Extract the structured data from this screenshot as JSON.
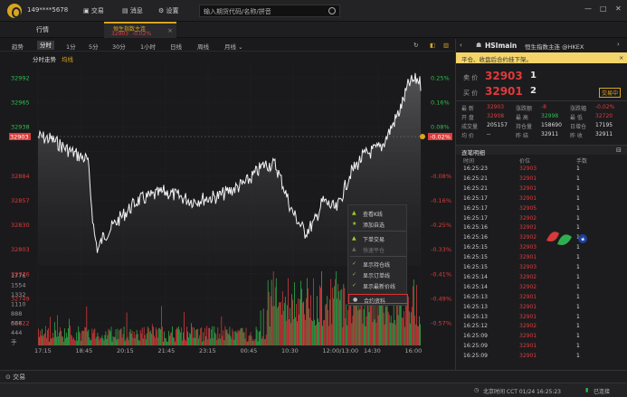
{
  "topbar": {
    "account": "149****5678",
    "menu": [
      {
        "label": "交易",
        "icon": "trade-icon"
      },
      {
        "label": "消息",
        "icon": "message-icon"
      },
      {
        "label": "设置",
        "icon": "gear-icon"
      }
    ],
    "search_placeholder": "输入期货代码/名称/拼音"
  },
  "tabs": {
    "main": "行情",
    "active_title": "恒生指数主连",
    "active_price": "32903",
    "active_change": "-0.02%"
  },
  "periods": [
    "分时",
    "1分",
    "5分",
    "30分",
    "1小时",
    "日线",
    "周线",
    "月线"
  ],
  "period_first": "趋势",
  "selected_period": "分时",
  "sub": {
    "mode": "分时走势",
    "avg": "均线"
  },
  "chart": {
    "left_ticks": [
      "32992",
      "32965",
      "32938",
      "32911",
      "32884",
      "32857",
      "32830",
      "32803",
      "32776",
      "32749",
      "32722"
    ],
    "pct_ticks": [
      "0.25%",
      "0.16%",
      "0.08%",
      "0.00%",
      "-0.08%",
      "-0.16%",
      "-0.25%",
      "-0.33%",
      "-0.41%",
      "-0.49%",
      "-0.57%"
    ],
    "current": "32903",
    "current_pct": "-0.02%",
    "vol_ticks": [
      "1776",
      "1554",
      "1332",
      "1110",
      "888",
      "666",
      "444",
      "手"
    ],
    "time_ticks": [
      "17:15",
      "18:45",
      "20:15",
      "21:45",
      "23:15",
      "00:45",
      "10:30",
      "12:00/13:00",
      "14:30",
      "16:00"
    ]
  },
  "context_menu": [
    {
      "label": "查看K线",
      "icon": "chart-icon",
      "disabled": false
    },
    {
      "label": "添加自选",
      "icon": "star-icon",
      "disabled": false
    },
    {
      "label": "下单交易",
      "icon": "order-icon",
      "disabled": false
    },
    {
      "label": "快速平仓",
      "icon": "close-pos-icon",
      "disabled": true
    },
    {
      "label": "显示持仓线",
      "icon": "check-icon",
      "disabled": false
    },
    {
      "label": "显示订单线",
      "icon": "check-icon",
      "disabled": false
    },
    {
      "label": "显示最新价线",
      "icon": "check-icon",
      "disabled": false
    },
    {
      "label": "合约资料",
      "icon": "info-icon",
      "disabled": false,
      "highlighted": true
    }
  ],
  "quote": {
    "symbol": "HSImain",
    "name": "恒生指数主连 @HKEX",
    "notice": "平仓、收盘后合约挂下架。",
    "sell_label": "卖 价",
    "sell_price": "32903",
    "sell_qty": "1",
    "buy_label": "买 价",
    "buy_price": "32901",
    "buy_qty": "2",
    "trade_btn": "交易中",
    "stats": [
      [
        "最 新",
        "32903",
        "涨跌额",
        "-8",
        "涨跌幅",
        "-0.02%"
      ],
      [
        "开 盘",
        "32908",
        "最 高",
        "32998",
        "最 低",
        "32720"
      ],
      [
        "成交量",
        "205157",
        "持仓量",
        "158690",
        "日增仓",
        "17195"
      ],
      [
        "均 价",
        "--",
        "昨 结",
        "32911",
        "昨 收",
        "32911"
      ]
    ],
    "ticks_title": "逐笔明细",
    "ticks_headers": [
      "时间",
      "价位",
      "手数"
    ],
    "ticks": [
      [
        "16:25:23",
        "32903",
        "1"
      ],
      [
        "16:25:21",
        "32901",
        "1"
      ],
      [
        "16:25:21",
        "32901",
        "1"
      ],
      [
        "16:25:17",
        "32901",
        "1"
      ],
      [
        "16:25:17",
        "32905",
        "1"
      ],
      [
        "16:25:17",
        "32902",
        "1"
      ],
      [
        "16:25:16",
        "32901",
        "1"
      ],
      [
        "16:25:16",
        "32902",
        "1"
      ],
      [
        "16:25:15",
        "32903",
        "1"
      ],
      [
        "16:25:15",
        "32901",
        "1"
      ],
      [
        "16:25:15",
        "32903",
        "1"
      ],
      [
        "16:25:14",
        "32902",
        "1"
      ],
      [
        "16:25:14",
        "32902",
        "1"
      ],
      [
        "16:25:13",
        "32901",
        "1"
      ],
      [
        "16:25:13",
        "32901",
        "1"
      ],
      [
        "16:25:13",
        "32901",
        "1"
      ],
      [
        "16:25:12",
        "32902",
        "1"
      ],
      [
        "16:25:09",
        "32901",
        "1"
      ],
      [
        "16:25:09",
        "32901",
        "1"
      ],
      [
        "16:25:09",
        "32901",
        "1"
      ]
    ]
  },
  "status": {
    "trade": "交易",
    "clock": "北京时间 CCT  01/24 16:25:23",
    "conn": "已连接"
  },
  "colors": {
    "up": "#e03a3a",
    "down": "#2fbf4f",
    "accent": "#d9a520"
  }
}
